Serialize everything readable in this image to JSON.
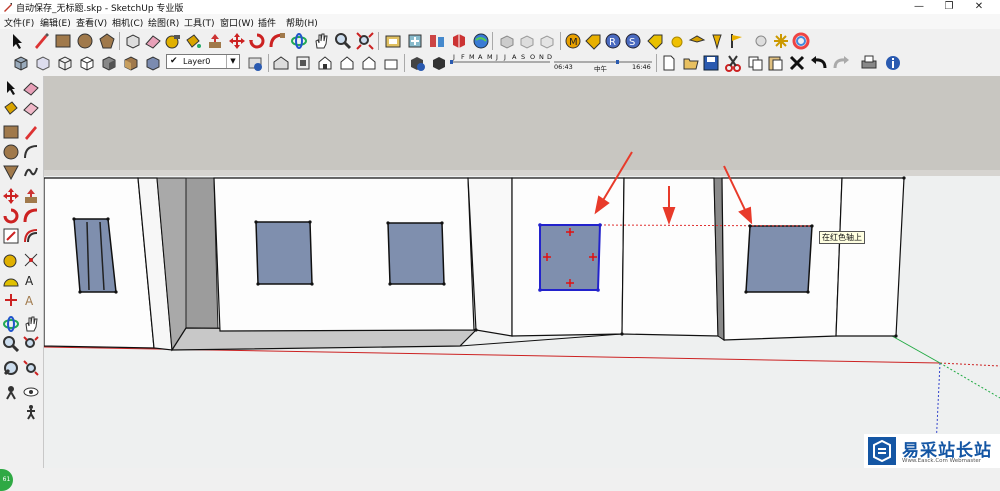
{
  "window": {
    "title": "自动保存_无标题.skp - SketchUp 专业版",
    "minimize_glyph": "—",
    "restore_glyph": "❐",
    "close_glyph": "✕"
  },
  "menu": [
    "文件(F)",
    "编辑(E)",
    "查看(V)",
    "相机(C)",
    "绘图(R)",
    "工具(T)",
    "窗口(W)",
    "插件",
    "帮助(H)"
  ],
  "layer": {
    "check": "✔",
    "name": "Layer0",
    "arrow": "▼"
  },
  "shadow": {
    "months": [
      "J",
      "F",
      "M",
      "A",
      "M",
      "J",
      "J",
      "A",
      "S",
      "O",
      "N",
      "D"
    ],
    "time_start": "06:43",
    "time_mid": "中午",
    "time_end": "16:46"
  },
  "viewport": {
    "tooltip": "在红色轴上",
    "badge": "61"
  },
  "watermark": {
    "main": "易采站长站",
    "sub": "Www.Easck.Com  Webmaster"
  },
  "colors": {
    "accent_blue": "#1456a4",
    "window_glass": "#7f8fae",
    "selection_blue": "#2222cc",
    "red_axis": "#cc2222",
    "annotation_red": "#e83a2a"
  }
}
